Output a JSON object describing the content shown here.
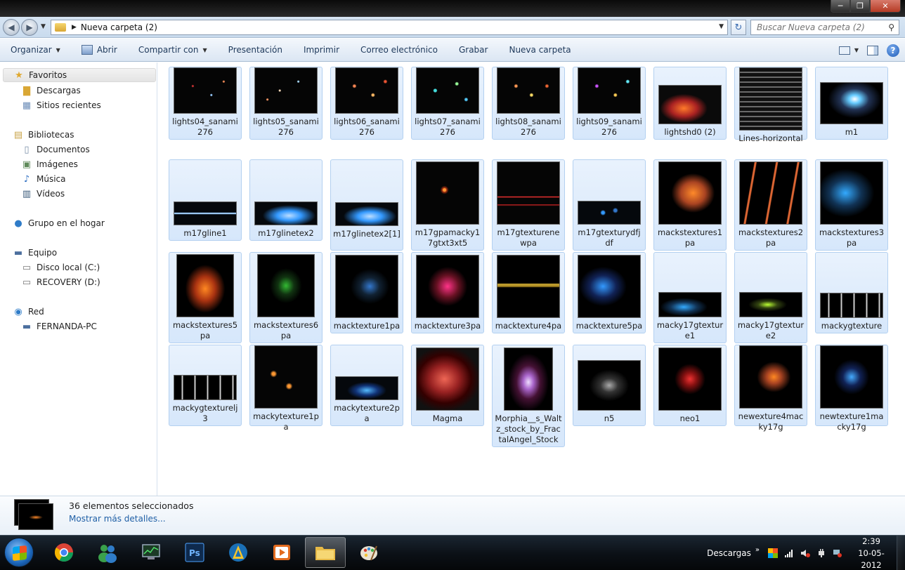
{
  "window": {
    "address_path": "Nueva carpeta (2)",
    "search_placeholder": "Buscar Nueva carpeta (2)",
    "caption_minimize": "─",
    "caption_maximize": "❐",
    "caption_close": "✕"
  },
  "toolbar": {
    "organizar": "Organizar",
    "abrir": "Abrir",
    "compartir": "Compartir con",
    "presentacion": "Presentación",
    "imprimir": "Imprimir",
    "correo": "Correo electrónico",
    "grabar": "Grabar",
    "nueva_carpeta": "Nueva carpeta"
  },
  "navpane": {
    "favoritos": "Favoritos",
    "descargas": "Descargas",
    "sitios": "Sitios recientes",
    "bibliotecas": "Bibliotecas",
    "documentos": "Documentos",
    "imagenes": "Imágenes",
    "musica": "Música",
    "videos": "Vídeos",
    "grupo": "Grupo en el hogar",
    "equipo": "Equipo",
    "disco": "Disco local (C:)",
    "recovery": "RECOVERY (D:)",
    "red": "Red",
    "pc": "FERNANDA-PC"
  },
  "files": [
    {
      "name": "lights04_sanami276"
    },
    {
      "name": "lights05_sanami276"
    },
    {
      "name": "lights06_sanami276"
    },
    {
      "name": "lights07_sanami276"
    },
    {
      "name": "lights08_sanami276"
    },
    {
      "name": "lights09_sanami276"
    },
    {
      "name": "lightshd0 (2)"
    },
    {
      "name": "Lines-horizontal"
    },
    {
      "name": "m1"
    },
    {
      "name": "m17gline1"
    },
    {
      "name": "m17glinetex2"
    },
    {
      "name": "m17glinetex2[1]"
    },
    {
      "name": "m17gpamacky17gtxt3xt5"
    },
    {
      "name": "m17gtexturenewpa"
    },
    {
      "name": "m17gtexturydfjdf"
    },
    {
      "name": "mackstextures1pa"
    },
    {
      "name": "mackstextures2pa"
    },
    {
      "name": "mackstextures3pa"
    },
    {
      "name": "mackstextures5pa"
    },
    {
      "name": "mackstextures6pa"
    },
    {
      "name": "macktexture1pa"
    },
    {
      "name": "macktexture3pa"
    },
    {
      "name": "macktexture4pa"
    },
    {
      "name": "macktexture5pa"
    },
    {
      "name": "macky17gtexture1"
    },
    {
      "name": "macky17gtexture2"
    },
    {
      "name": "mackygtexture"
    },
    {
      "name": "mackygtexturelj3"
    },
    {
      "name": "mackytexture1pa"
    },
    {
      "name": "mackytexture2pa"
    },
    {
      "name": "Magma"
    },
    {
      "name": "Morphia__s_Waltz_stock_by_FractalAngel_Stock"
    },
    {
      "name": "n5"
    },
    {
      "name": "neo1"
    },
    {
      "name": "newexture4macky17g"
    },
    {
      "name": "newtexture1macky17g"
    }
  ],
  "details": {
    "count": "36 elementos seleccionados",
    "more": "Mostrar más detalles..."
  },
  "taskbar": {
    "tray_label": "Descargas",
    "chevron": "»",
    "time": "2:39",
    "date": "10-05-2012"
  }
}
